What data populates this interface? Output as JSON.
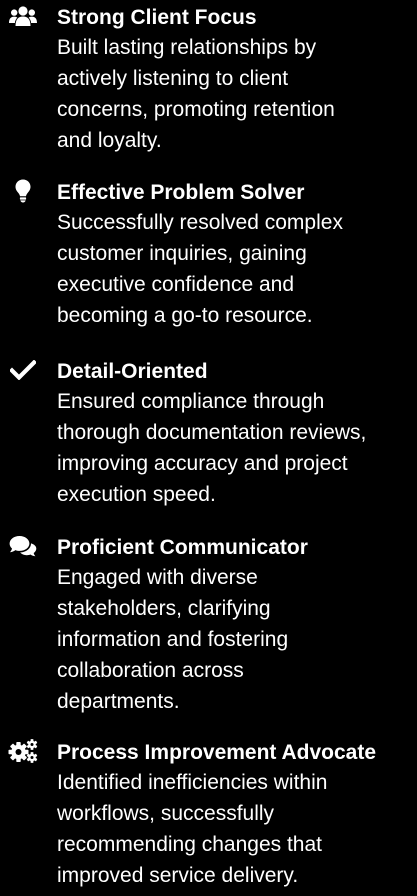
{
  "strengths": [
    {
      "icon": "users-icon",
      "title": "Strong Client Focus",
      "lines": [
        "Built lasting relationships by",
        "actively listening to client",
        "concerns, promoting retention",
        "and loyalty."
      ]
    },
    {
      "icon": "lightbulb-icon",
      "title": "Effective Problem Solver",
      "lines": [
        "Successfully resolved complex",
        "customer inquiries, gaining",
        "executive confidence and",
        "becoming a go-to resource."
      ]
    },
    {
      "icon": "checkmark-icon",
      "title": "Detail-Oriented",
      "lines": [
        "Ensured compliance through",
        "thorough documentation reviews,",
        "improving accuracy and project",
        "execution speed."
      ]
    },
    {
      "icon": "comments-icon",
      "title": "Proficient Communicator",
      "lines": [
        "Engaged with diverse",
        "stakeholders, clarifying",
        "information and fostering",
        "collaboration across",
        "departments."
      ]
    },
    {
      "icon": "gears-icon",
      "title": "Process Improvement Advocate",
      "lines": [
        "Identified inefficiencies within",
        "workflows, successfully",
        "recommending changes that",
        "improved service delivery."
      ]
    }
  ],
  "colors": {
    "background": "#000000",
    "text": "#ffffff"
  }
}
